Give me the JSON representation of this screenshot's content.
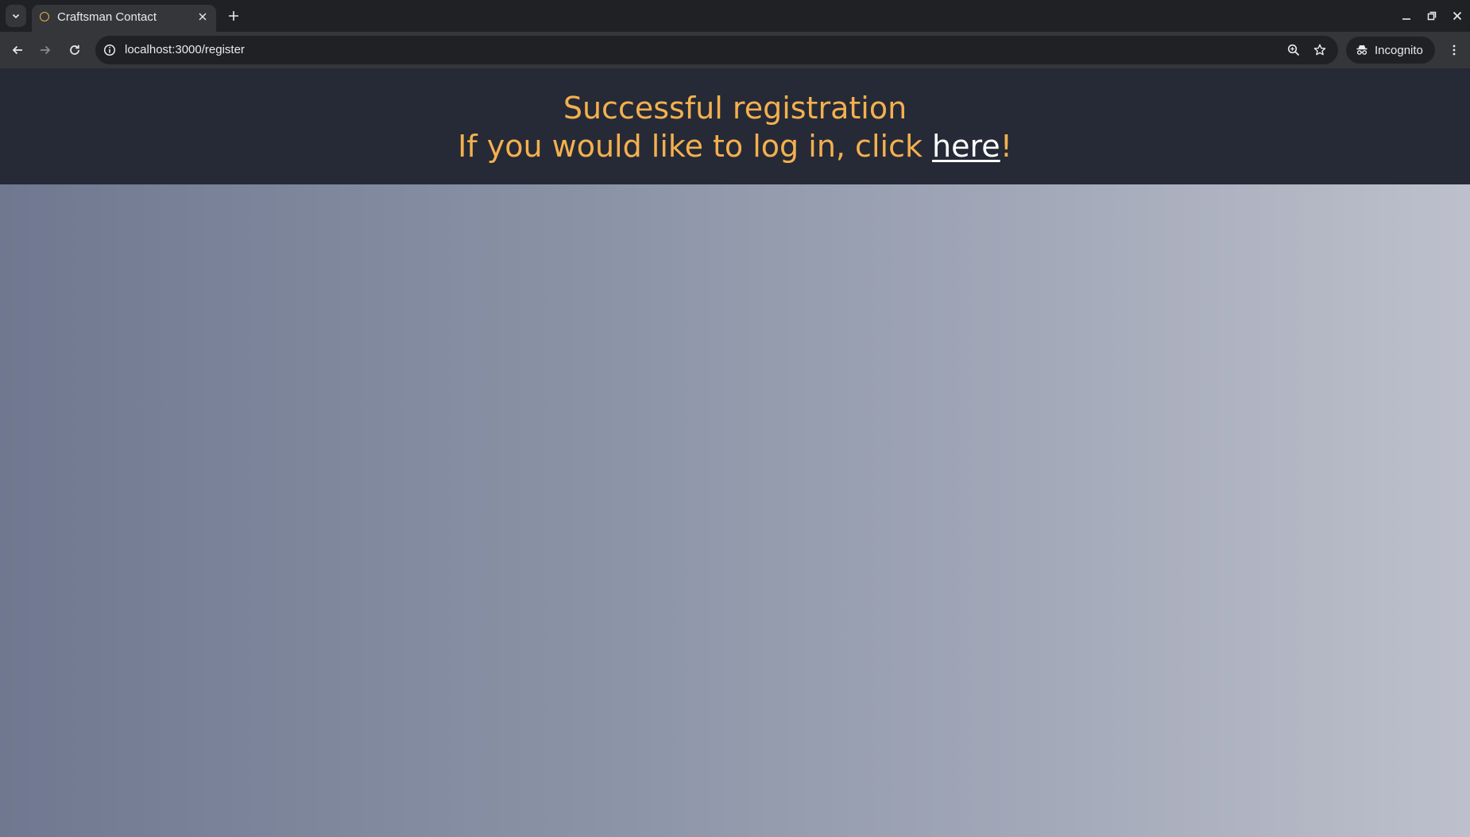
{
  "browser": {
    "tab": {
      "title": "Craftsman Contact",
      "favicon_color": "#e8b04a"
    },
    "address_bar": {
      "url": "localhost:3000/register"
    },
    "profile": {
      "label": "Incognito"
    }
  },
  "page": {
    "heading_line1": "Successful registration",
    "heading_line2_prefix": "If you would like to log in, click ",
    "login_link_label": "here",
    "heading_line2_suffix": "!",
    "accent_color": "#f4b04f",
    "banner_color": "#262a36"
  }
}
